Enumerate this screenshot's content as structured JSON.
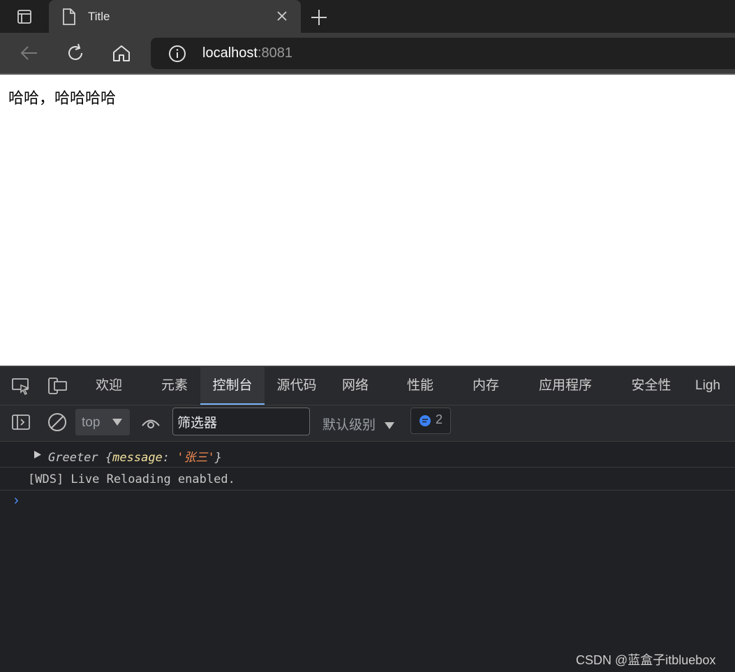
{
  "browser": {
    "tab": {
      "title": "Title"
    },
    "address": {
      "host": "localhost",
      "port": ":8081"
    }
  },
  "page": {
    "text": "哈哈，哈哈哈哈"
  },
  "devtools": {
    "tabs": [
      "欢迎",
      "元素",
      "控制台",
      "源代码",
      "网络",
      "性能",
      "内存",
      "应用程序",
      "安全性",
      "Ligh"
    ],
    "active_tab": "控制台",
    "console": {
      "context": "top",
      "filter_value": "筛选器",
      "level": "默认级别",
      "issues_count": "2",
      "logs": [
        {
          "class_name": "Greeter",
          "key": "message",
          "value": "'张三'"
        },
        {
          "text": "[WDS] Live Reloading enabled."
        }
      ],
      "prompt": "›"
    }
  },
  "watermark": "CSDN @蓝盒子itbluebox",
  "colors": {
    "accent": "#7ab4f8",
    "prompt": "#4c8dff",
    "string": "#f28b54",
    "key": "#f2e29f"
  }
}
